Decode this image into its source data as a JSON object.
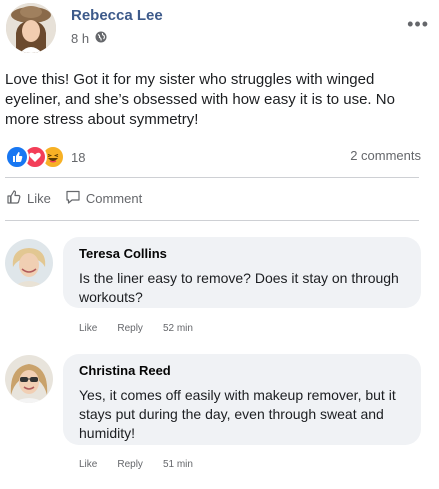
{
  "post": {
    "author": "Rebecca Lee",
    "time": "8 h",
    "privacy_icon": "globe-icon",
    "more_label": "•••",
    "text": "Love this! Got it for my sister who struggles with winged eyeliner, and she’s obsessed with how easy it is to use. No more stress about symmetry!",
    "reaction_count": "18",
    "reaction_icons": [
      "like-reaction-icon",
      "love-reaction-icon",
      "haha-reaction-icon"
    ],
    "comments_count": "2 comments"
  },
  "actions": {
    "like": "Like",
    "comment": "Comment"
  },
  "comments": [
    {
      "name": "Teresa Collins",
      "text": "Is the liner easy to remove? Does it stay on through workouts?",
      "like": "Like",
      "reply": "Reply",
      "time": "52 min"
    },
    {
      "name": "Christina Reed",
      "text": "Yes, it comes off easily with makeup remover, but it stays put during the day, even through sweat and humidity!",
      "like": "Like",
      "reply": "Reply",
      "time": "51 min"
    }
  ],
  "colors": {
    "author_name": "#3d5a8a",
    "muted": "#65676b",
    "bubble": "#f0f2f5",
    "like_blue": "#1877f2",
    "love_red": "#f33e58",
    "haha_yellow": "#f7b125"
  }
}
